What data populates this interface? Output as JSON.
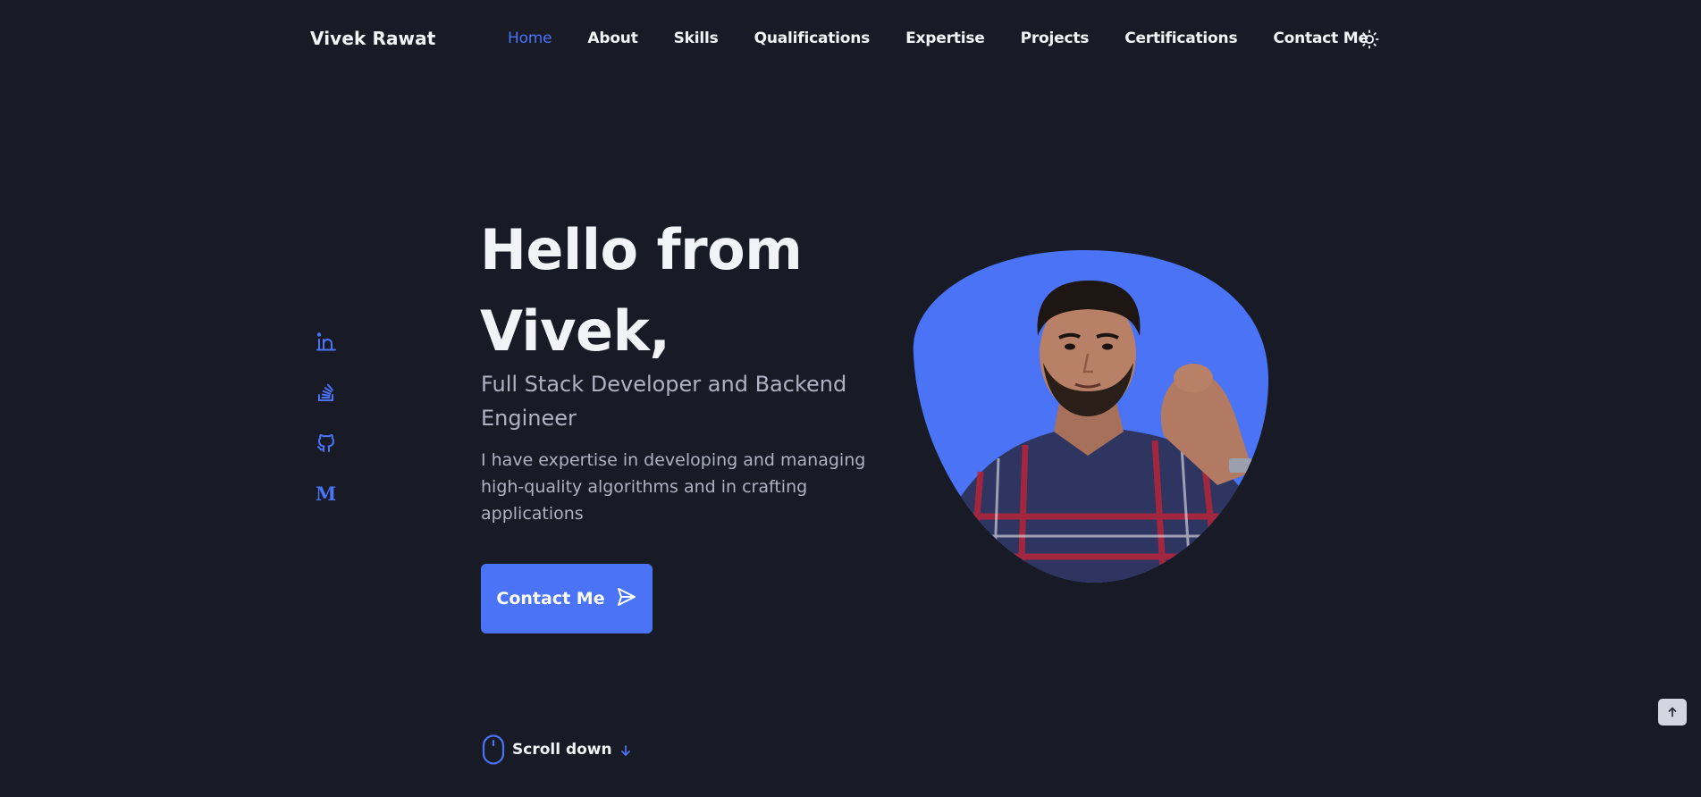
{
  "header": {
    "logo": "Vivek Rawat",
    "nav": [
      {
        "label": "Home",
        "active": true
      },
      {
        "label": "About"
      },
      {
        "label": "Skills"
      },
      {
        "label": "Qualifications"
      },
      {
        "label": "Expertise"
      },
      {
        "label": "Projects"
      },
      {
        "label": "Certifications"
      },
      {
        "label": "Contact Me"
      }
    ],
    "theme_icon": "sun-icon"
  },
  "social": [
    {
      "icon": "linkedin-icon"
    },
    {
      "icon": "stackoverflow-icon"
    },
    {
      "icon": "github-icon"
    },
    {
      "icon": "medium-icon",
      "glyph": "M"
    }
  ],
  "hero": {
    "title": "Hello from Vivek,",
    "subtitle": "Full Stack Developer and Backend Engineer",
    "description": "I have expertise in developing and managing high-quality algorithms and in crafting applications",
    "cta_label": "Contact Me",
    "cta_icon": "send-icon"
  },
  "scroll_down": {
    "label": "Scroll down",
    "icon": "mouse-icon",
    "arrow_icon": "arrow-down-icon"
  },
  "scroll_top": {
    "icon": "arrow-up-icon"
  },
  "colors": {
    "background": "#181b26",
    "accent": "#4a73f5",
    "text": "#f2f3f7",
    "muted": "#aeb2c2"
  }
}
